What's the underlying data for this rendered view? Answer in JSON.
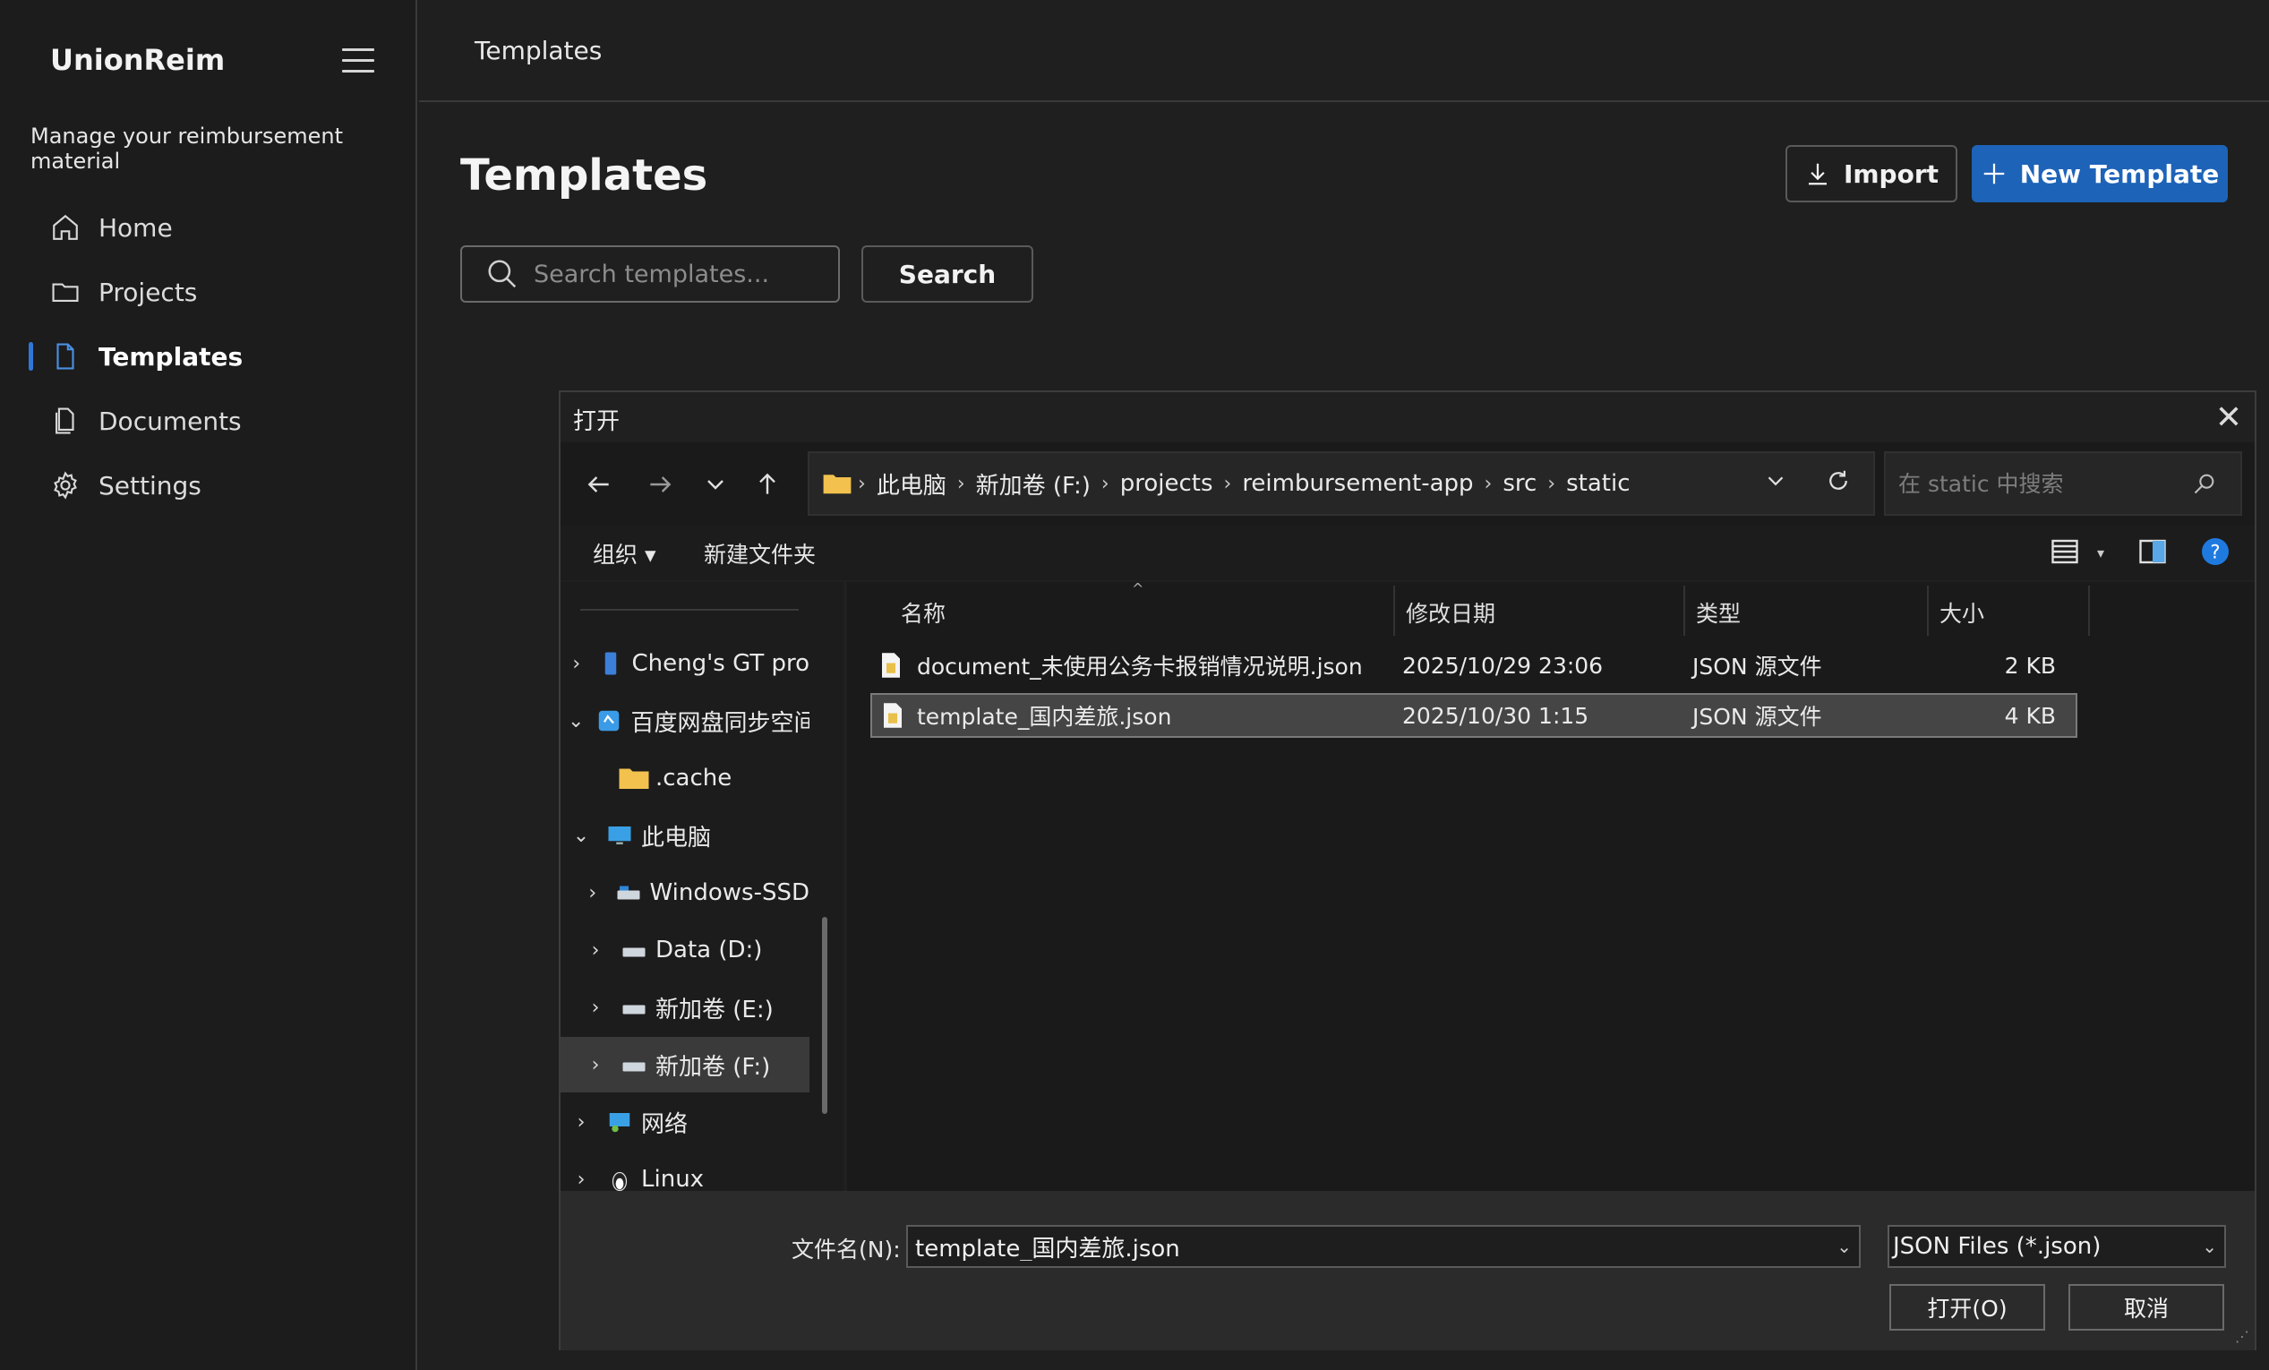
{
  "app": {
    "brand": "UnionReim",
    "tagline": "Manage your reimbursement material",
    "topbar_title": "Templates",
    "page_title": "Templates",
    "accent_color": "#1d63b8"
  },
  "sidebar": {
    "items": [
      {
        "label": "Home",
        "icon": "home-icon"
      },
      {
        "label": "Projects",
        "icon": "folder-icon"
      },
      {
        "label": "Templates",
        "icon": "document-icon",
        "active": true
      },
      {
        "label": "Documents",
        "icon": "documents-icon"
      },
      {
        "label": "Settings",
        "icon": "gear-icon"
      }
    ]
  },
  "toolbar": {
    "import_label": "Import",
    "new_template_label": "New Template",
    "search_placeholder": "Search templates...",
    "search_label": "Search"
  },
  "dialog": {
    "title": "打开",
    "close_glyph": "✕",
    "breadcrumb": [
      "此电脑",
      "新加卷 (F:)",
      "projects",
      "reimbursement-app",
      "src",
      "static"
    ],
    "search_placeholder": "在 static 中搜索",
    "commands": {
      "organize": "组织 ▾",
      "new_folder": "新建文件夹"
    },
    "tree": [
      {
        "chev": "›",
        "label": "Cheng's GT pro",
        "icon": "phone-icon",
        "indent": 0
      },
      {
        "chev": "⌄",
        "label": "百度网盘同步空间",
        "icon": "cloud-sync-icon",
        "indent": 0
      },
      {
        "chev": "",
        "label": ".cache",
        "icon": "folder-icon",
        "indent": 1
      },
      {
        "chev": "⌄",
        "label": "此电脑",
        "icon": "computer-icon",
        "indent": 0
      },
      {
        "chev": "›",
        "label": "Windows-SSD",
        "icon": "drive-icon",
        "indent": 1
      },
      {
        "chev": "›",
        "label": "Data (D:)",
        "icon": "drive-icon",
        "indent": 1
      },
      {
        "chev": "›",
        "label": "新加卷 (E:)",
        "icon": "drive-icon",
        "indent": 1
      },
      {
        "chev": "›",
        "label": "新加卷 (F:)",
        "icon": "drive-icon",
        "indent": 1,
        "selected": true
      },
      {
        "chev": "›",
        "label": "网络",
        "icon": "network-icon",
        "indent": 0
      },
      {
        "chev": "›",
        "label": "Linux",
        "icon": "linux-icon",
        "indent": 0
      }
    ],
    "columns": {
      "name": "名称",
      "modified": "修改日期",
      "type": "类型",
      "size": "大小"
    },
    "files": [
      {
        "name": "document_未使用公务卡报销情况说明.json",
        "modified": "2025/10/29 23:06",
        "type": "JSON 源文件",
        "size": "2 KB"
      },
      {
        "name": "template_国内差旅.json",
        "modified": "2025/10/30 1:15",
        "type": "JSON 源文件",
        "size": "4 KB",
        "selected": true
      }
    ],
    "filename_label": "文件名(N):",
    "filename_value": "template_国内差旅.json",
    "filetype_value": "JSON Files (*.json)",
    "open_label": "打开(O)",
    "cancel_label": "取消"
  }
}
